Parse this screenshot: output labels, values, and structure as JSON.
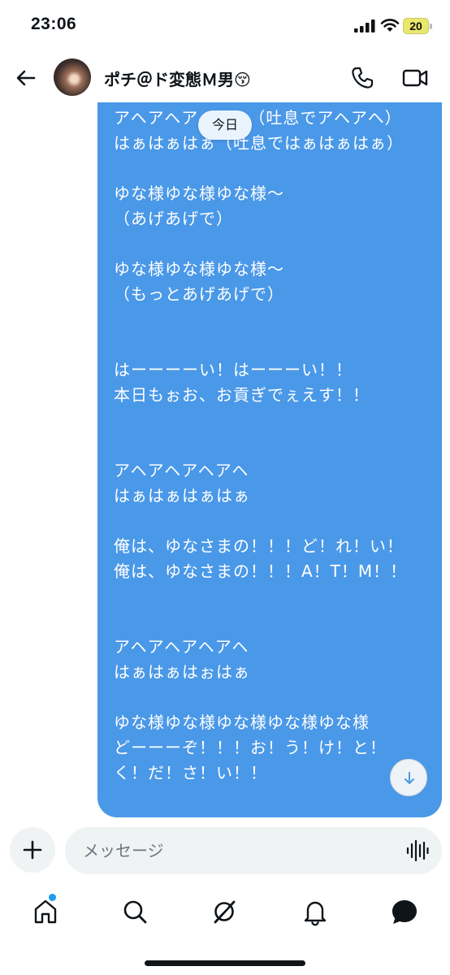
{
  "status_bar": {
    "time": "23:06",
    "battery": "20",
    "icons": [
      "signal-icon",
      "wifi-icon",
      "battery-icon"
    ]
  },
  "header": {
    "contact_name": "ポチ＠ド変態Ｍ男😚",
    "icons": [
      "back-arrow-icon",
      "avatar",
      "phone-icon",
      "video-camera-icon"
    ]
  },
  "conversation": {
    "date_label": "今日",
    "message_text": "アヘアヘアヘアヘ（吐息でアヘアヘ）\nはぁはぁはぁ（吐息ではぁはぁはぁ）\n\nゆな様ゆな様ゆな様〜\n（あげあげで）\n\nゆな様ゆな様ゆな様〜\n（もっとあげあげで）\n\n\nはーーーーい！はーーーい！！\n本日もぉお、お貢ぎでぇえす！！\n\n\nアヘアヘアヘアヘ\nはぁはぁはぁはぁ\n\n俺は、ゆなさまの！！！ど！れ！い！\n俺は、ゆなさまの！！！A！T！M！！\n\n\nアヘアヘアヘアヘ\nはぁはぁはぉはぁ\n\nゆな様ゆな様ゆな様ゆな様ゆな様\nどーーーぞ！！！お！う！け！と！\nく！だ！さ！い！！",
    "bubble_color": "#4a98e8",
    "scroll_button_icon": "arrow-down-icon"
  },
  "composer": {
    "placeholder": "メッセージ",
    "icons": [
      "plus-icon",
      "voice-wave-icon"
    ]
  },
  "tab_bar": {
    "tabs": [
      "home-icon",
      "search-icon",
      "grok-icon",
      "bell-icon",
      "messages-icon"
    ],
    "accent": "#1d9bf0"
  }
}
